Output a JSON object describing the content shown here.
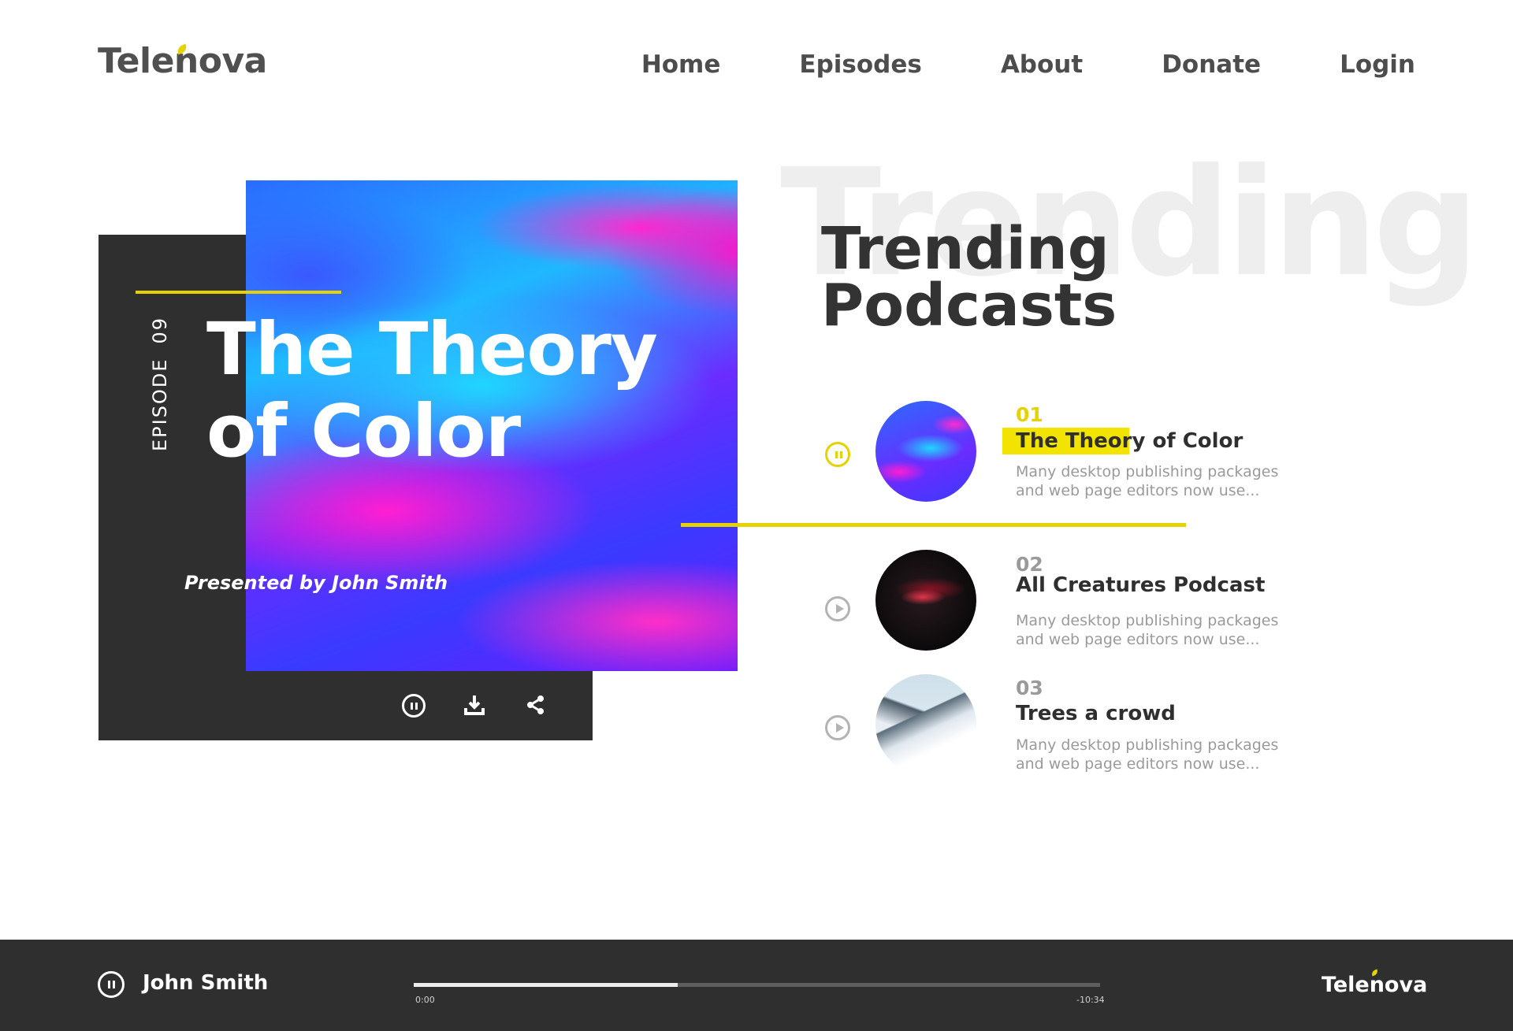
{
  "header": {
    "logo": "Telenova",
    "nav": [
      "Home",
      "Episodes",
      "About",
      "Donate",
      "Login"
    ]
  },
  "feature": {
    "episode_label": "EPISODE",
    "episode_number": "09",
    "title_line1": "The Theory",
    "title_line2": "of Color",
    "presenter": "Presented by John Smith",
    "controls": [
      "pause-icon",
      "download-icon",
      "share-icon"
    ]
  },
  "trending": {
    "background_word": "Trending",
    "title_line1": "Trending",
    "title_line2": "Podcasts",
    "items": [
      {
        "number": "01",
        "title": "The Theory of Color",
        "description_line1": "Many desktop publishing packages",
        "description_line2": "and web page editors now use...",
        "state": "playing"
      },
      {
        "number": "02",
        "title": "All Creatures Podcast",
        "description_line1": "Many desktop publishing packages",
        "description_line2": "and web page editors now use...",
        "state": "paused"
      },
      {
        "number": "03",
        "title": "Trees a crowd",
        "description_line1": "Many desktop publishing packages",
        "description_line2": "and web page editors now use...",
        "state": "paused"
      }
    ]
  },
  "player": {
    "presenter_name": "John Smith",
    "current_time": "0:00",
    "remaining_time": "-10:34",
    "progress": 0.385,
    "logo": "Telenova"
  },
  "colors": {
    "accent": "#e6d200",
    "dark": "#2f2f2f",
    "muted": "#9a9a9a"
  }
}
